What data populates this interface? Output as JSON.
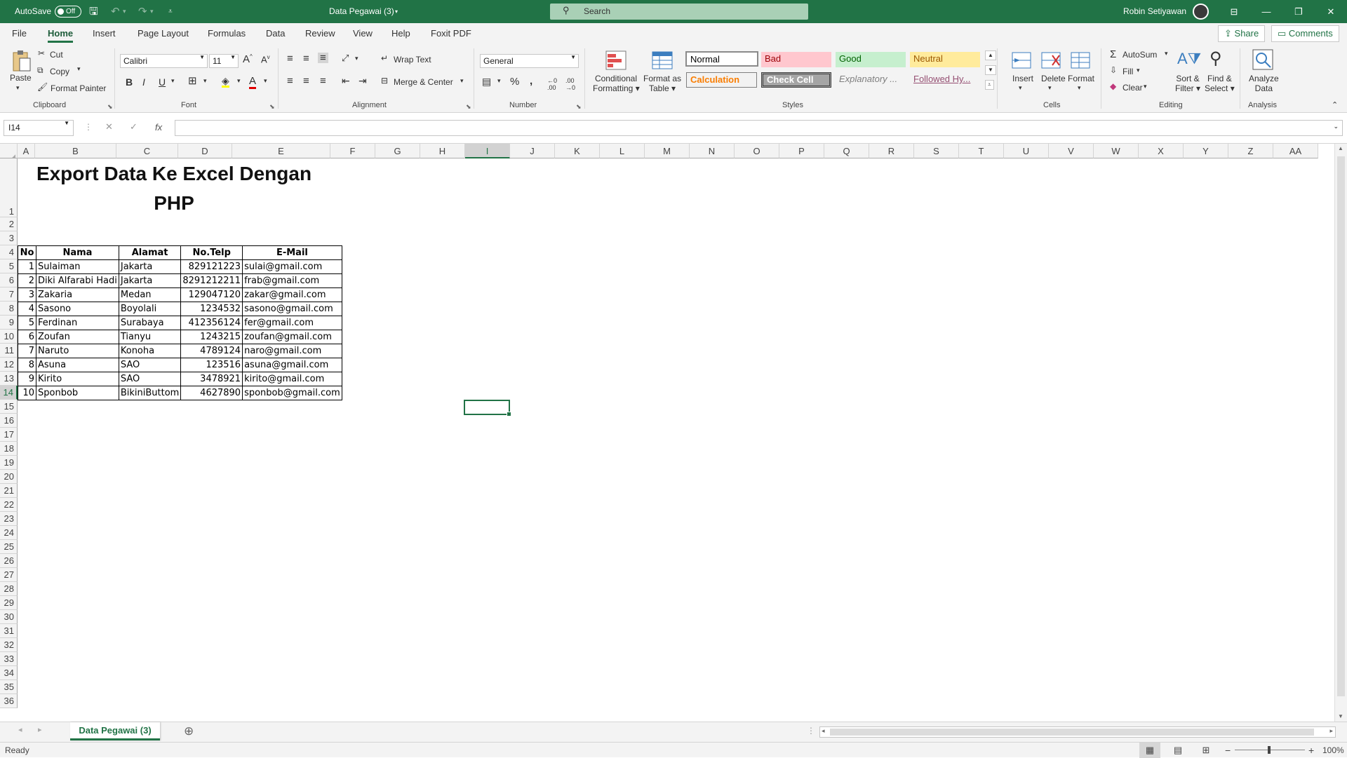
{
  "titlebar": {
    "autosave_label": "AutoSave",
    "toggle_state": "Off",
    "doc_title": "Data Pegawai (3)",
    "search_placeholder": "Search",
    "user_name": "Robin Setiyawan"
  },
  "menu": [
    "File",
    "Home",
    "Insert",
    "Page Layout",
    "Formulas",
    "Data",
    "Review",
    "View",
    "Help",
    "Foxit PDF"
  ],
  "active_tab": "Home",
  "share_label": "Share",
  "comments_label": "Comments",
  "ribbon": {
    "clipboard": {
      "paste": "Paste",
      "cut": "Cut",
      "copy": "Copy",
      "format_painter": "Format Painter",
      "group": "Clipboard"
    },
    "font": {
      "name": "Calibri",
      "size": "11",
      "group": "Font"
    },
    "alignment": {
      "wrap_text": "Wrap Text",
      "merge_center": "Merge & Center",
      "group": "Alignment"
    },
    "number": {
      "format": "General",
      "group": "Number"
    },
    "styles": {
      "conditional": [
        "Conditional",
        "Formatting"
      ],
      "format_table": [
        "Format as",
        "Table"
      ],
      "normal": "Normal",
      "bad": "Bad",
      "good": "Good",
      "neutral": "Neutral",
      "calculation": "Calculation",
      "check_cell": "Check Cell",
      "explanatory": "Explanatory ...",
      "followed": "Followed Hy...",
      "group": "Styles"
    },
    "cells": {
      "insert": "Insert",
      "delete": "Delete",
      "format": "Format",
      "group": "Cells"
    },
    "editing": {
      "autosum": "AutoSum",
      "fill": "Fill",
      "clear": "Clear",
      "sort": [
        "Sort &",
        "Filter"
      ],
      "find": [
        "Find &",
        "Select"
      ],
      "group": "Editing"
    },
    "analysis": {
      "analyze": [
        "Analyze",
        "Data"
      ],
      "group": "Analysis"
    }
  },
  "formula_bar": {
    "name_box": "I14",
    "fx": "fx",
    "content": ""
  },
  "columns": [
    "A",
    "B",
    "C",
    "D",
    "E",
    "F",
    "G",
    "H",
    "I",
    "J",
    "K",
    "L",
    "M",
    "N",
    "O",
    "P",
    "Q",
    "R",
    "S",
    "T",
    "U",
    "V",
    "W",
    "X",
    "Y",
    "Z",
    "AA"
  ],
  "selected_column": "I",
  "selected_row": "14",
  "rows": [
    "1",
    "2",
    "3",
    "4",
    "5",
    "6",
    "7",
    "8",
    "9",
    "10",
    "11",
    "12",
    "13",
    "14",
    "15",
    "16",
    "17",
    "18",
    "19",
    "20",
    "21",
    "22",
    "23",
    "24",
    "25",
    "26",
    "27",
    "28",
    "29",
    "30",
    "31",
    "32",
    "33",
    "34",
    "35",
    "36"
  ],
  "sheet_title": [
    "Export Data Ke Excel Dengan",
    "PHP"
  ],
  "table": {
    "headers": [
      "No",
      "Nama",
      "Alamat",
      "No.Telp",
      "E-Mail"
    ],
    "rows": [
      [
        "1",
        "Sulaiman",
        "Jakarta",
        "829121223",
        "sulai@gmail.com"
      ],
      [
        "2",
        "Diki Alfarabi Hadi",
        "Jakarta",
        "8291212211",
        "frab@gmail.com"
      ],
      [
        "3",
        "Zakaria",
        "Medan",
        "129047120",
        "zakar@gmail.com"
      ],
      [
        "4",
        "Sasono",
        "Boyolali",
        "1234532",
        "sasono@gmail.com"
      ],
      [
        "5",
        "Ferdinan",
        "Surabaya",
        "412356124",
        "fer@gmail.com"
      ],
      [
        "6",
        "Zoufan",
        "Tianyu",
        "1243215",
        "zoufan@gmail.com"
      ],
      [
        "7",
        "Naruto",
        "Konoha",
        "4789124",
        "naro@gmail.com"
      ],
      [
        "8",
        "Asuna",
        "SAO",
        "123516",
        "asuna@gmail.com"
      ],
      [
        "9",
        "Kirito",
        "SAO",
        "3478921",
        "kirito@gmail.com"
      ],
      [
        "10",
        "Sponbob",
        "BikiniButtom",
        "4627890",
        "sponbob@gmail.com"
      ]
    ]
  },
  "sheet_tab": "Data Pegawai (3)",
  "status": {
    "text": "Ready",
    "zoom": "100%"
  },
  "colors": {
    "accent": "#217346",
    "bad_bg": "#ffc7ce",
    "bad_fg": "#9c0006",
    "good_bg": "#c6efce",
    "good_fg": "#006100",
    "neutral_bg": "#ffeb9c",
    "neutral_fg": "#9c5700",
    "calc_fg": "#fa7d00",
    "check_bg": "#a5a5a5",
    "followed_fg": "#954f72"
  }
}
